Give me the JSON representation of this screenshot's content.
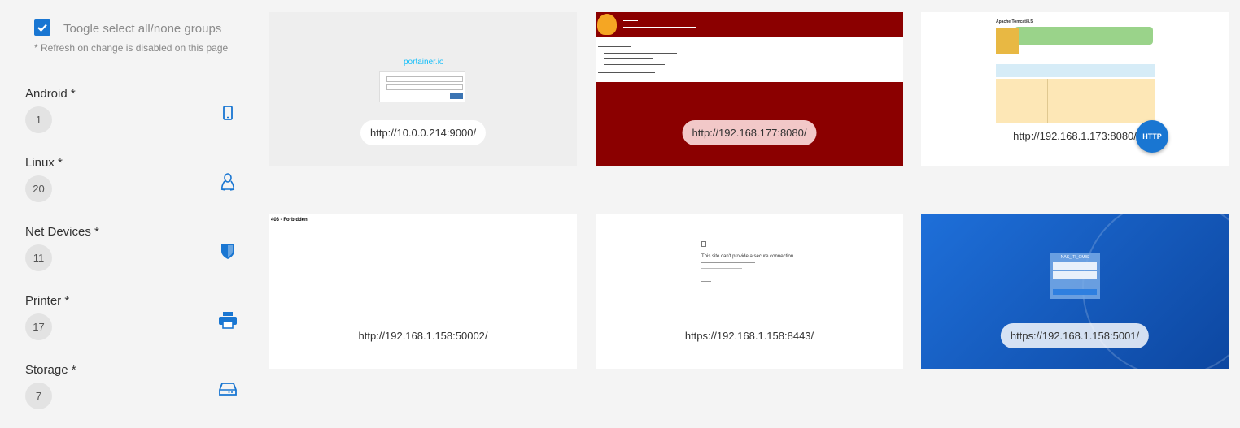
{
  "sidebar": {
    "toggle_label": "Toogle select all/none groups",
    "hint": "* Refresh on change is disabled on this page",
    "groups": [
      {
        "name": "Android *",
        "count": "1",
        "icon": "smartphone-icon"
      },
      {
        "name": "Linux *",
        "count": "20",
        "icon": "linux-icon"
      },
      {
        "name": "Net Devices *",
        "count": "11",
        "icon": "shield-icon"
      },
      {
        "name": "Printer *",
        "count": "17",
        "icon": "printer-icon"
      },
      {
        "name": "Storage *",
        "count": "7",
        "icon": "storage-icon"
      }
    ]
  },
  "cards": [
    {
      "url": "http://10.0.0.214:9000/",
      "preview": "portainer-login",
      "logo_text": "portainer.io"
    },
    {
      "url": "http://192.168.177:8080/",
      "preview": "red-error-page"
    },
    {
      "url": "http://192.168.1.173:8080/",
      "preview": "apache-tomcat",
      "badge": "HTTP",
      "page_title": "Apache Tomcat/8.5"
    },
    {
      "url": "http://192.168.1.158:50002/",
      "preview": "forbidden",
      "page_text": "403 - Forbidden"
    },
    {
      "url": "https://192.168.1.158:8443/",
      "preview": "secure-connection-error",
      "page_text": "This site can't provide a secure connection"
    },
    {
      "url": "https://192.168.1.158:5001/",
      "preview": "nas-login",
      "page_title": "NAS_ITI_OMIS"
    }
  ],
  "colors": {
    "accent": "#1976d2",
    "tomcat_red": "#8b0000",
    "nas_blue": "#1565c0"
  }
}
